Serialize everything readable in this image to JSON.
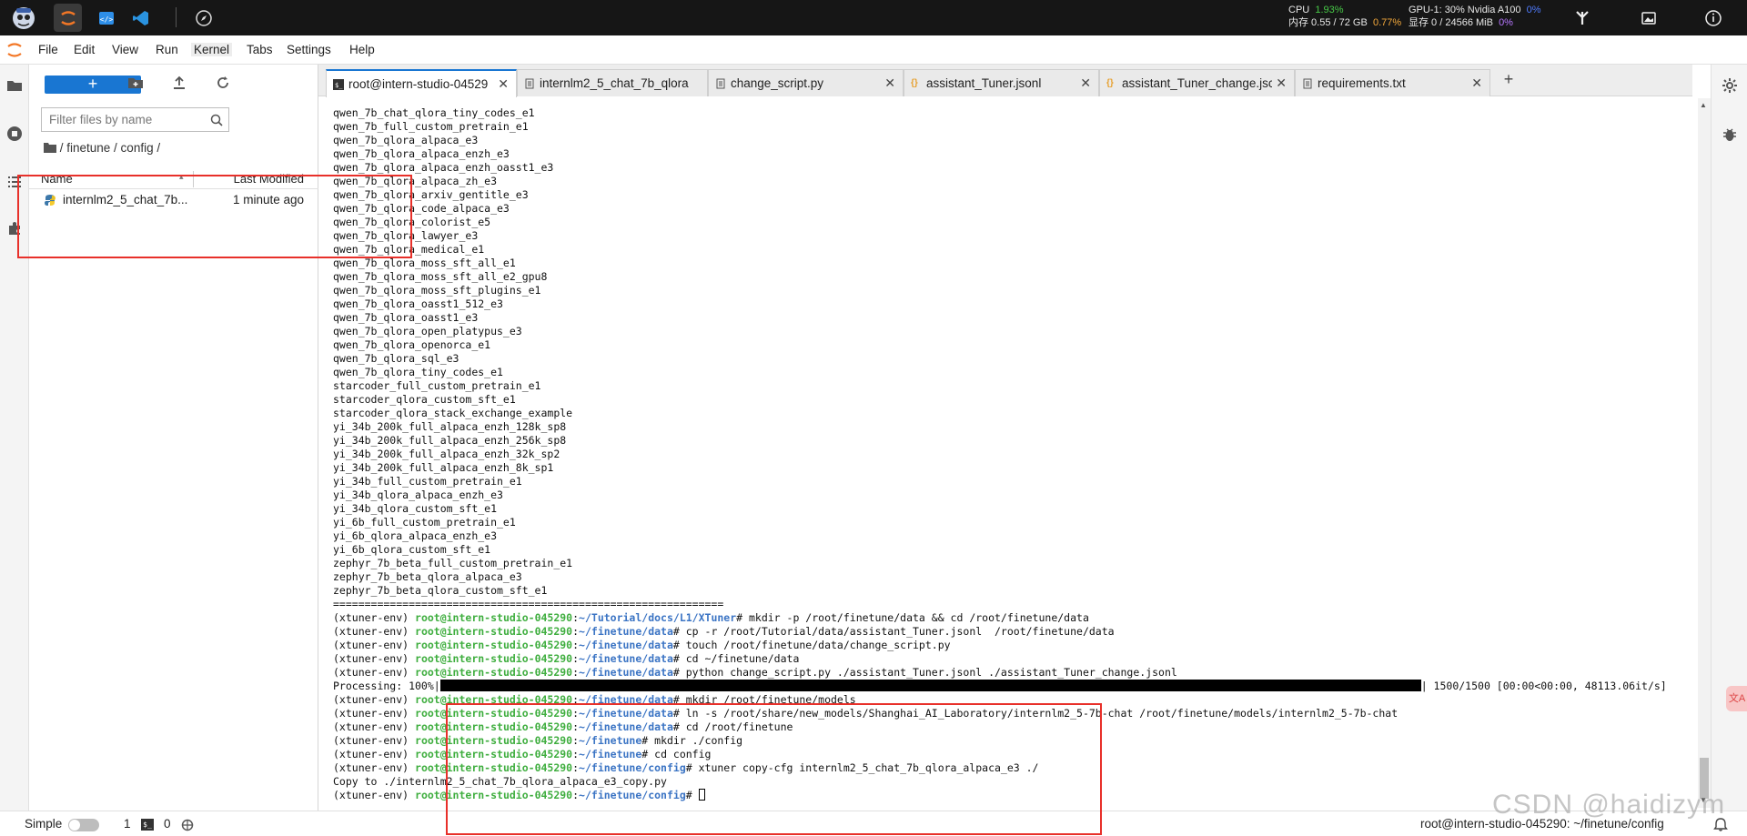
{
  "topbar": {
    "cpu_label": "CPU",
    "cpu_value": "1.93%",
    "mem_label": "内存 0.55 / 72 GB",
    "mem_value": "0.77%",
    "gpu_label": "GPU-1: 30% Nvidia A100",
    "gpu_value": "0%",
    "vram_label": "显存 0 / 24566 MiB",
    "vram_value": "0%"
  },
  "menu": [
    "File",
    "Edit",
    "View",
    "Run",
    "Kernel",
    "Tabs",
    "Settings",
    "Help"
  ],
  "filebrowser": {
    "new_label": "+",
    "filter_placeholder": "Filter files by name",
    "breadcrumb": "/ finetune / config /",
    "col_name": "Name",
    "col_modified": "Last Modified",
    "files": [
      {
        "name": "internlm2_5_chat_7b...",
        "modified": "1 minute ago"
      }
    ]
  },
  "tabs": [
    {
      "label": "root@intern-studio-04529",
      "icon": "terminal-icon"
    },
    {
      "label": "internlm2_5_chat_7b_qlora",
      "icon": "file-icon"
    },
    {
      "label": "change_script.py",
      "icon": "file-icon"
    },
    {
      "label": "assistant_Tuner.jsonl",
      "icon": "json-icon"
    },
    {
      "label": "assistant_Tuner_change.jsc",
      "icon": "json-icon"
    },
    {
      "label": "requirements.txt",
      "icon": "file-icon"
    }
  ],
  "terminal": {
    "list_lines": [
      "qwen_7b_chat_qlora_tiny_codes_e1",
      "qwen_7b_full_custom_pretrain_e1",
      "qwen_7b_qlora_alpaca_e3",
      "qwen_7b_qlora_alpaca_enzh_e3",
      "qwen_7b_qlora_alpaca_enzh_oasst1_e3",
      "qwen_7b_qlora_alpaca_zh_e3",
      "qwen_7b_qlora_arxiv_gentitle_e3",
      "qwen_7b_qlora_code_alpaca_e3",
      "qwen_7b_qlora_colorist_e5",
      "qwen_7b_qlora_lawyer_e3",
      "qwen_7b_qlora_medical_e1",
      "qwen_7b_qlora_moss_sft_all_e1",
      "qwen_7b_qlora_moss_sft_all_e2_gpu8",
      "qwen_7b_qlora_moss_sft_plugins_e1",
      "qwen_7b_qlora_oasst1_512_e3",
      "qwen_7b_qlora_oasst1_e3",
      "qwen_7b_qlora_open_platypus_e3",
      "qwen_7b_qlora_openorca_e1",
      "qwen_7b_qlora_sql_e3",
      "qwen_7b_qlora_tiny_codes_e1",
      "starcoder_full_custom_pretrain_e1",
      "starcoder_qlora_custom_sft_e1",
      "starcoder_qlora_stack_exchange_example",
      "yi_34b_200k_full_alpaca_enzh_128k_sp8",
      "yi_34b_200k_full_alpaca_enzh_256k_sp8",
      "yi_34b_200k_full_alpaca_enzh_32k_sp2",
      "yi_34b_200k_full_alpaca_enzh_8k_sp1",
      "yi_34b_full_custom_pretrain_e1",
      "yi_34b_qlora_alpaca_enzh_e3",
      "yi_34b_qlora_custom_sft_e1",
      "yi_6b_full_custom_pretrain_e1",
      "yi_6b_qlora_alpaca_enzh_e3",
      "yi_6b_qlora_custom_sft_e1",
      "zephyr_7b_beta_full_custom_pretrain_e1",
      "zephyr_7b_beta_qlora_alpaca_e3",
      "zephyr_7b_beta_qlora_custom_sft_e1",
      "=============================================================="
    ],
    "prompt_env": "(xtuner-env) ",
    "prompt_host": "root@intern-studio-045290",
    "commands": [
      {
        "path": "~/Tutorial/docs/L1/XTuner",
        "cmd": "# mkdir -p /root/finetune/data && cd /root/finetune/data"
      },
      {
        "path": "~/finetune/data",
        "cmd": "# cp -r /root/Tutorial/data/assistant_Tuner.jsonl  /root/finetune/data"
      },
      {
        "path": "~/finetune/data",
        "cmd": "# touch /root/finetune/data/change_script.py"
      },
      {
        "path": "~/finetune/data",
        "cmd": "# cd ~/finetune/data"
      },
      {
        "path": "~/finetune/data",
        "cmd": "# python change_script.py ./assistant_Tuner.jsonl ./assistant_Tuner_change.jsonl"
      }
    ],
    "processing_label": "Processing: 100%|",
    "processing_stats": "| 1500/1500 [00:00<00:00, 48113.06it/s]",
    "processing_fraction": 1.0,
    "commands2": [
      {
        "path": "~/finetune/data",
        "cmd": "# mkdir /root/finetune/models"
      },
      {
        "path": "~/finetune/data",
        "cmd": "# ln -s /root/share/new_models/Shanghai_AI_Laboratory/internlm2_5-7b-chat /root/finetune/models/internlm2_5-7b-chat"
      },
      {
        "path": "~/finetune/data",
        "cmd": "# cd /root/finetune"
      },
      {
        "path": "~/finetune",
        "cmd": "# mkdir ./config"
      },
      {
        "path": "~/finetune",
        "cmd": "# cd config"
      },
      {
        "path": "~/finetune/config",
        "cmd": "# xtuner copy-cfg internlm2_5_chat_7b_qlora_alpaca_e3 ./"
      }
    ],
    "copy_output": "Copy to ./internlm2_5_chat_7b_qlora_alpaca_e3_copy.py",
    "last_path": "~/finetune/config",
    "last_cmd": "# "
  },
  "statusbar": {
    "mode": "Simple",
    "count1": "1",
    "count2": "0",
    "right": "root@intern-studio-045290: ~/finetune/config"
  },
  "watermark": "CSDN @haidizym"
}
